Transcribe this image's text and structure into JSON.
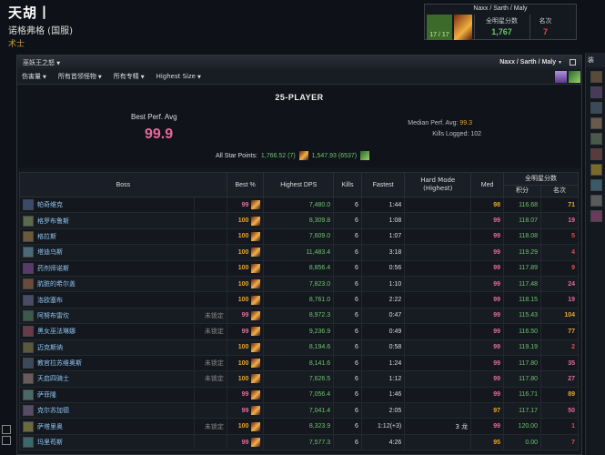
{
  "character": {
    "name": "天胡丨",
    "server": "诺格弗格 (国服)",
    "class": "术士"
  },
  "zone_box": {
    "title": "Naxx / Sarth / Maly",
    "progress": "17 / 17",
    "stars_label": "全明星分数",
    "stars_value": "1,767",
    "rank_label": "名次",
    "rank_value": "7"
  },
  "side_panel": {
    "title": "装"
  },
  "panel": {
    "title": "巫妖王之怒",
    "zone": "Naxx / Sarth / Maly",
    "filters": [
      "伤害量",
      "所有首领怪物",
      "所有专精",
      "Highest Size"
    ]
  },
  "summary": {
    "title": "25-PLAYER",
    "best_perf_label": "Best Perf. Avg",
    "best_perf_value": "99.9",
    "median_label": "Median Perf. Avg:",
    "median_value": "99.3",
    "kills_label": "Kills Logged:",
    "kills_value": "102",
    "star_label": "All Star Points:",
    "star_value_1": "1,766.52 (7)",
    "star_value_2": "1,547.93 (6537)"
  },
  "table": {
    "headers": {
      "boss": "Boss",
      "best": "Best %",
      "dps": "Highest DPS",
      "kills": "Kills",
      "fastest": "Fastest",
      "hard_mode": "Hard Mode (Highest)",
      "med": "Med",
      "stars_group": "全明星分数",
      "points": "积分",
      "rank": "名次"
    },
    "rows": [
      {
        "boss": "帕奇维克",
        "lock": "",
        "best": "99",
        "dps": "7,480.0",
        "kills": "6",
        "fastest": "1:44",
        "hm": "",
        "med": "98",
        "points": "116.68",
        "rank": "71"
      },
      {
        "boss": "格罗布鲁斯",
        "lock": "",
        "best": "100",
        "dps": "8,309.8",
        "kills": "6",
        "fastest": "1:08",
        "hm": "",
        "med": "99",
        "points": "118.07",
        "rank": "19"
      },
      {
        "boss": "格拉斯",
        "lock": "",
        "best": "100",
        "dps": "7,609.0",
        "kills": "6",
        "fastest": "1:07",
        "hm": "",
        "med": "99",
        "points": "118.08",
        "rank": "5"
      },
      {
        "boss": "塔迪乌斯",
        "lock": "",
        "best": "100",
        "dps": "11,483.4",
        "kills": "6",
        "fastest": "3:18",
        "hm": "",
        "med": "99",
        "points": "119.29",
        "rank": "4"
      },
      {
        "boss": "药剂师诺斯",
        "lock": "",
        "best": "100",
        "dps": "8,856.4",
        "kills": "6",
        "fastest": "0:56",
        "hm": "",
        "med": "99",
        "points": "117.89",
        "rank": "9"
      },
      {
        "boss": "肮脏的希尔盖",
        "lock": "",
        "best": "100",
        "dps": "7,823.0",
        "kills": "6",
        "fastest": "1:10",
        "hm": "",
        "med": "99",
        "points": "117.48",
        "rank": "24"
      },
      {
        "boss": "洛欧塞布",
        "lock": "",
        "best": "100",
        "dps": "8,761.0",
        "kills": "6",
        "fastest": "2:22",
        "hm": "",
        "med": "99",
        "points": "118.15",
        "rank": "19"
      },
      {
        "boss": "阿努布雷坎",
        "lock": "未锁定",
        "best": "99",
        "dps": "8,972.3",
        "kills": "6",
        "fastest": "0:47",
        "hm": "",
        "med": "99",
        "points": "115.43",
        "rank": "104"
      },
      {
        "boss": "黑女巫法琳娜",
        "lock": "未锁定",
        "best": "99",
        "dps": "9,236.9",
        "kills": "6",
        "fastest": "0:49",
        "hm": "",
        "med": "99",
        "points": "116.50",
        "rank": "77"
      },
      {
        "boss": "迈克斯纳",
        "lock": "",
        "best": "100",
        "dps": "8,194.6",
        "kills": "6",
        "fastest": "0:58",
        "hm": "",
        "med": "99",
        "points": "119.19",
        "rank": "2"
      },
      {
        "boss": "教官拉苏维奥斯",
        "lock": "未锁定",
        "best": "100",
        "dps": "8,141.6",
        "kills": "6",
        "fastest": "1:24",
        "hm": "",
        "med": "99",
        "points": "117.80",
        "rank": "35"
      },
      {
        "boss": "天启四骑士",
        "lock": "未锁定",
        "best": "100",
        "dps": "7,626.5",
        "kills": "6",
        "fastest": "1:12",
        "hm": "",
        "med": "99",
        "points": "117.80",
        "rank": "27"
      },
      {
        "boss": "萨菲隆",
        "lock": "",
        "best": "99",
        "dps": "7,056.4",
        "kills": "6",
        "fastest": "1:46",
        "hm": "",
        "med": "99",
        "points": "116.71",
        "rank": "89"
      },
      {
        "boss": "克尔苏加德",
        "lock": "",
        "best": "99",
        "dps": "7,041.4",
        "kills": "6",
        "fastest": "2:05",
        "hm": "",
        "med": "97",
        "points": "117.17",
        "rank": "50"
      },
      {
        "boss": "萨塔里奥",
        "lock": "未锁定",
        "best": "100",
        "dps": "8,323.9",
        "kills": "6",
        "fastest": "1:12(+3)",
        "hm": "3 龙",
        "med": "99",
        "points": "120.00",
        "rank": "1"
      },
      {
        "boss": "玛里苟斯",
        "lock": "",
        "best": "99",
        "dps": "7,577.3",
        "kills": "6",
        "fastest": "4:26",
        "hm": "",
        "med": "95",
        "points": "0.00",
        "rank": "7"
      }
    ]
  },
  "colors": {
    "pink": "#e26b9b",
    "orange": "#e8a62c",
    "green": "#6fc36f",
    "link": "#8fc4f0",
    "red": "#e24a4a"
  },
  "icons": [
    "spec-icon",
    "wand-icon",
    "window-icon",
    "boss-portrait-icon",
    "star-points-icon"
  ]
}
